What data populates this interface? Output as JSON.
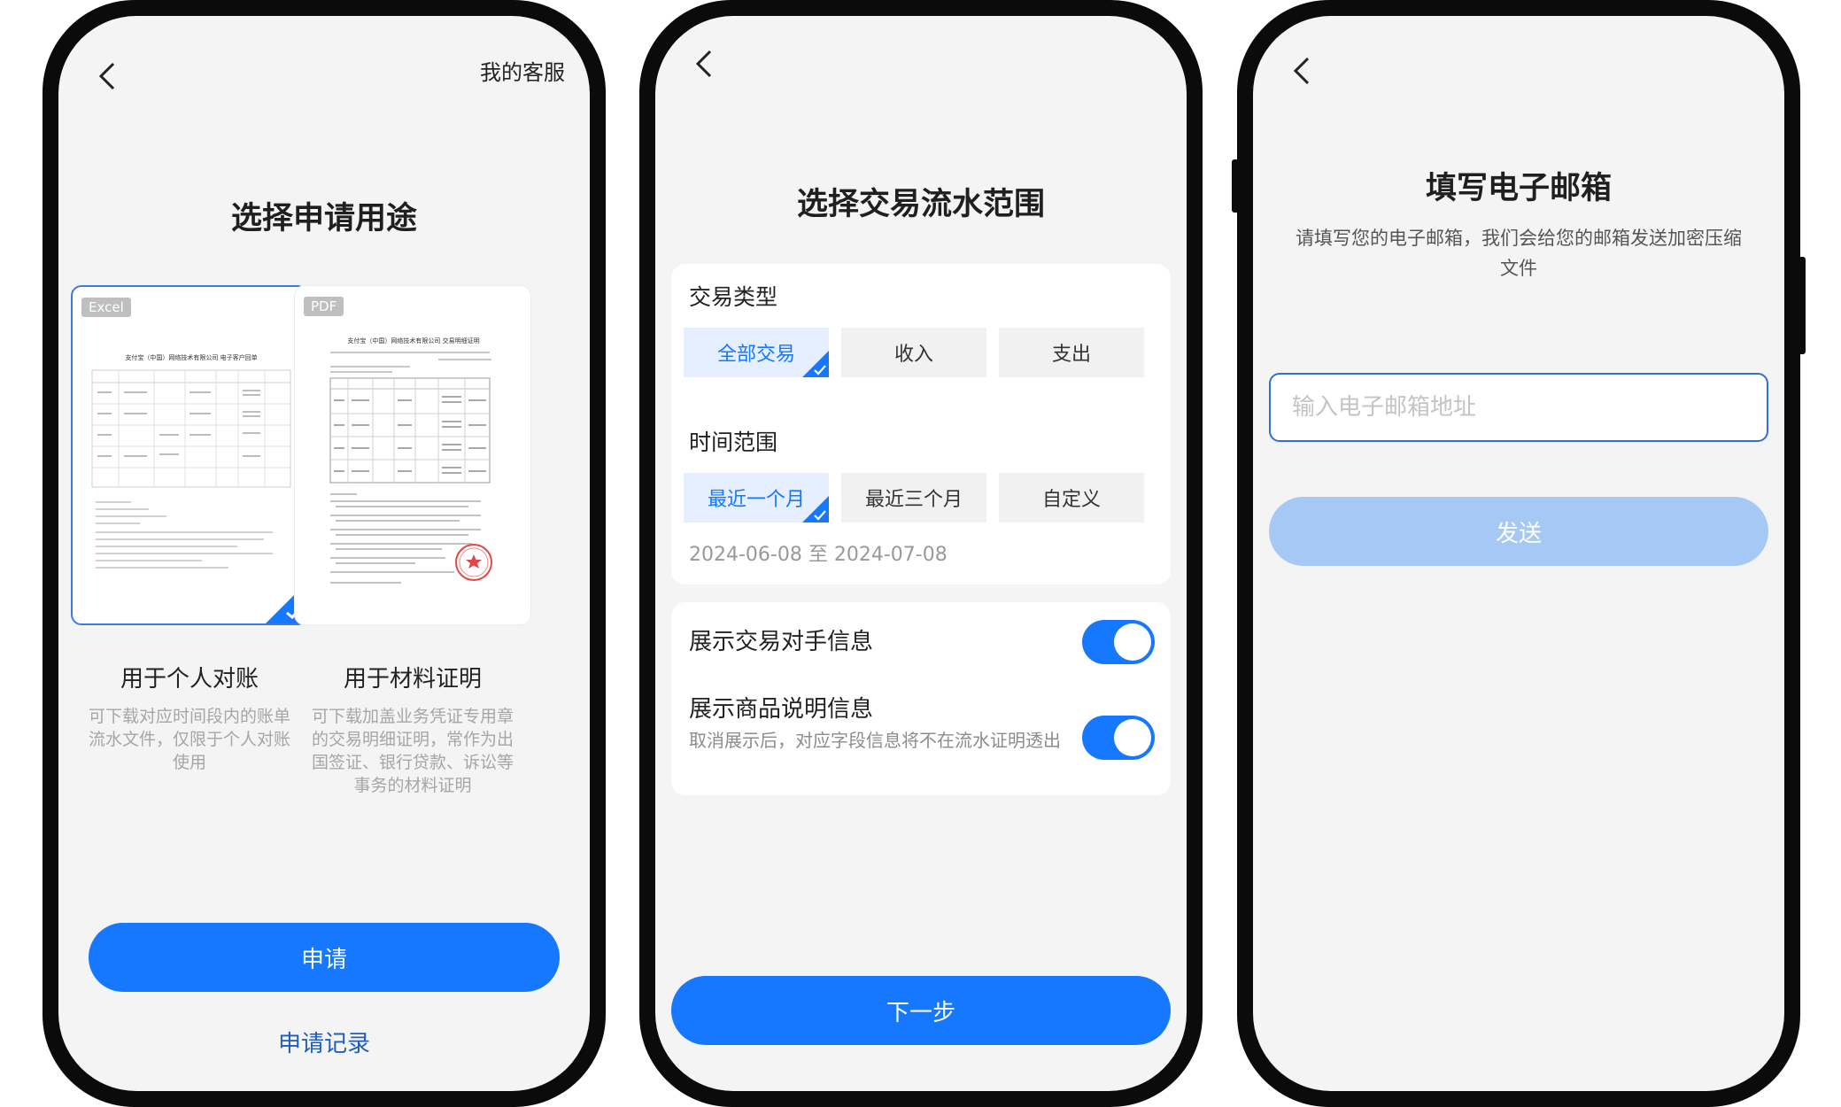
{
  "purpose_screen": {
    "customer_service": "我的客服",
    "title": "选择申请用途",
    "options": [
      {
        "badge": "Excel",
        "doc_heading": "支付宝（中国）网络技术有限公司 电子客户回单",
        "title": "用于个人对账",
        "desc": "可下载对应时间段内的账单流水文件，仅限于个人对账使用"
      },
      {
        "badge": "PDF",
        "doc_heading": "支付宝（中国）网络技术有限公司 交易明细证明",
        "title": "用于材料证明",
        "desc": "可下载加盖业务凭证专用章的交易明细证明，常作为出国签证、银行贷款、诉讼等事务的材料证明"
      }
    ],
    "apply_button": "申请",
    "record_link": "申请记录"
  },
  "range_screen": {
    "title": "选择交易流水范围",
    "type_label": "交易类型",
    "type_options": [
      "全部交易",
      "收入",
      "支出"
    ],
    "time_label": "时间范围",
    "time_options": [
      "最近一个月",
      "最近三个月",
      "自定义"
    ],
    "date_range": "2024-06-08 至 2024-07-08",
    "toggle1_label": "展示交易对手信息",
    "toggle2_label": "展示商品说明信息",
    "toggle2_desc": "取消展示后，对应字段信息将不在流水证明透出",
    "next_button": "下一步"
  },
  "email_screen": {
    "title": "填写电子邮箱",
    "subtitle": "请填写您的电子邮箱，我们会给您的邮箱发送加密压缩文件",
    "placeholder": "输入电子邮箱地址",
    "send_button": "发送"
  },
  "colors": {
    "primary": "#1677ff",
    "primary_disabled": "#a6c8f5",
    "background": "#f4f4f5"
  }
}
